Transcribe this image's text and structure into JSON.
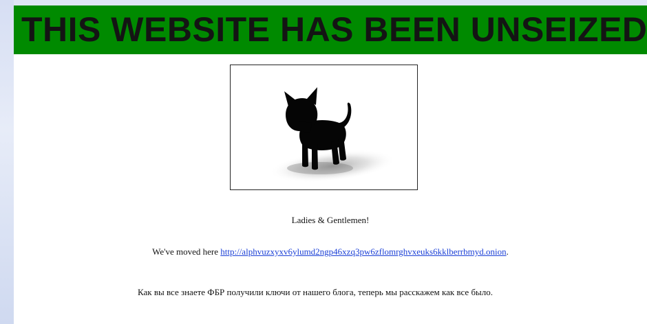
{
  "banner": {
    "title": "THIS WEBSITE HAS BEEN UNSEIZED",
    "background_color": "#008a00"
  },
  "image": {
    "subject": "black-kitten-silhouette"
  },
  "message": {
    "greeting": "Ladies & Gentlemen!",
    "moved_prefix": "We've moved here ",
    "moved_link": "http://alphvuzxyxv6ylumd2ngp46xzq3pw6zflomrghvxeuks6kklberrbmyd.onion",
    "moved_suffix": ".",
    "link_color": "#1a3fd6"
  },
  "story": {
    "paragraph": "Как вы все знаете ФБР получили ключи от нашего блога, теперь мы расскажем как все было."
  }
}
